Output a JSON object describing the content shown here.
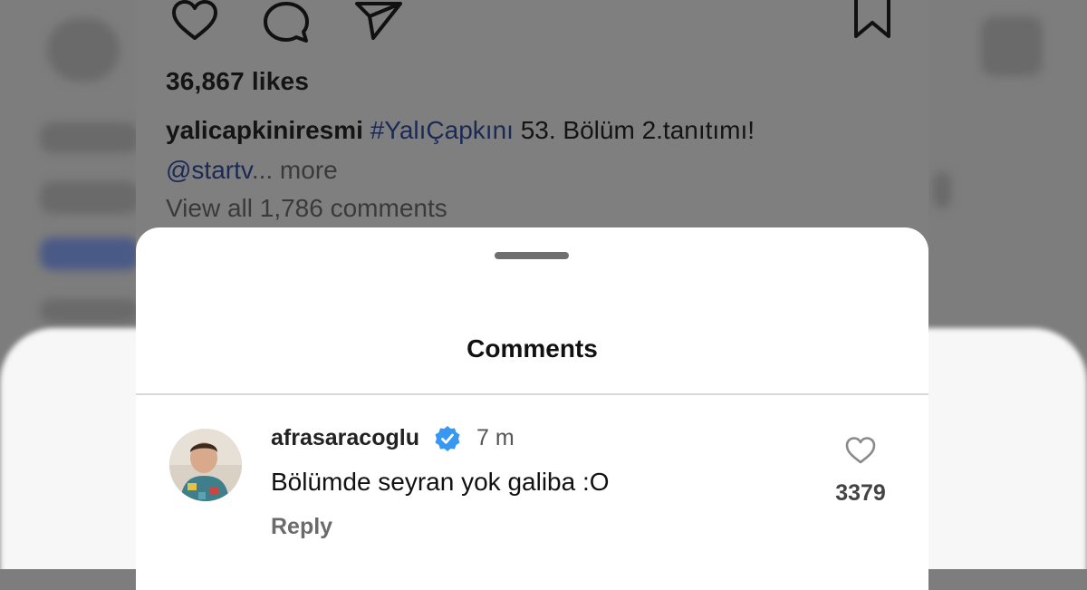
{
  "post": {
    "likes_text": "36,867 likes",
    "caption_user": "yalicapkiniresmi",
    "caption_hashtag": "#YalıÇapkını",
    "caption_rest": " 53. Bölüm 2.tanıtımı!",
    "caption_mention": "@startv",
    "caption_more": "... more",
    "view_all": "View all 1,786 comments",
    "icons": [
      "heart-icon",
      "comment-icon",
      "send-icon",
      "bookmark-icon"
    ]
  },
  "sheet": {
    "title": "Comments"
  },
  "comment": {
    "username": "afrasaracoglu",
    "verified": true,
    "time": "7 m",
    "text": "Bölümde seyran yok galiba :O",
    "reply_label": "Reply",
    "like_count": "3379"
  },
  "colors": {
    "overlay": "#7f7f7f",
    "verified_blue": "#3897f0",
    "hashtag": "#1b2a55"
  }
}
